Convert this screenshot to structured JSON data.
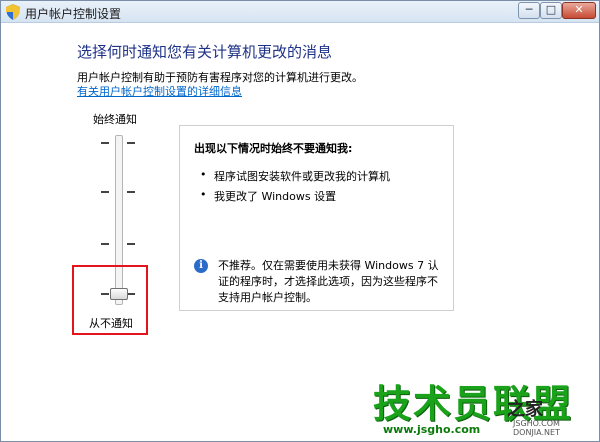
{
  "window": {
    "title": "用户帐户控制设置",
    "controls": {
      "minimize": "─",
      "maximize": "□",
      "close": "✕"
    }
  },
  "header": {
    "heading": "选择何时通知您有关计算机更改的消息",
    "description": "用户帐户控制有助于预防有害程序对您的计算机进行更改。",
    "link": "有关用户帐户控制设置的详细信息"
  },
  "slider": {
    "top_label": "始终通知",
    "bottom_label": "从不通知",
    "level": 0,
    "levels": 4
  },
  "panel": {
    "title": "出现以下情况时始终不要通知我:",
    "items": [
      "程序试图安装软件或更改我的计算机",
      "我更改了 Windows 设置"
    ],
    "note": "不推荐。仅在需要使用未获得 Windows 7 认证的程序时，才选择此选项，因为这些程序不支持用户帐户控制。"
  },
  "watermark": {
    "main": "技术员联盟",
    "home": "之家",
    "url": "www.jsgho.com",
    "url2": "JSGHO.COM DONJIA.NET"
  },
  "colors": {
    "heading": "#1e3287",
    "link": "#0066cc",
    "highlight": "#e3141b",
    "watermark": "#1aa31a"
  }
}
